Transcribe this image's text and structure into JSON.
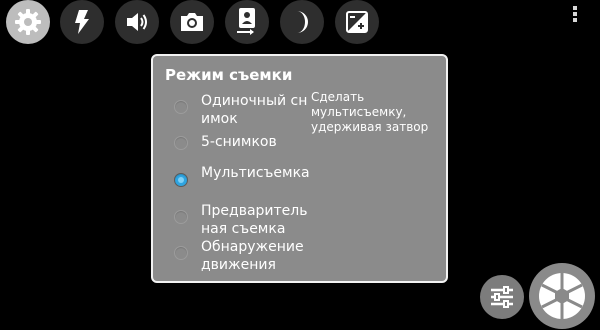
{
  "toolbar": {
    "icons": [
      "gear-icon",
      "flash-icon",
      "volume-icon",
      "camera-icon",
      "switch-camera-icon",
      "night-mode-icon",
      "exposure-icon"
    ],
    "active": "gear-icon"
  },
  "panel": {
    "title": "Режим съемки",
    "description": "Сделать мультисъемку, удерживая затвор",
    "options": [
      {
        "label": "Одиночный снимок",
        "checked": false
      },
      {
        "label": "5-снимков",
        "checked": false
      },
      {
        "label": "Мультисъемка",
        "checked": true
      },
      {
        "label": "Предварительная съемка",
        "checked": false
      },
      {
        "label": "Обнаружение движения",
        "checked": false
      }
    ]
  },
  "colors": {
    "panel_bg": "#8b8b8b",
    "accent": "#2fa4e0"
  }
}
